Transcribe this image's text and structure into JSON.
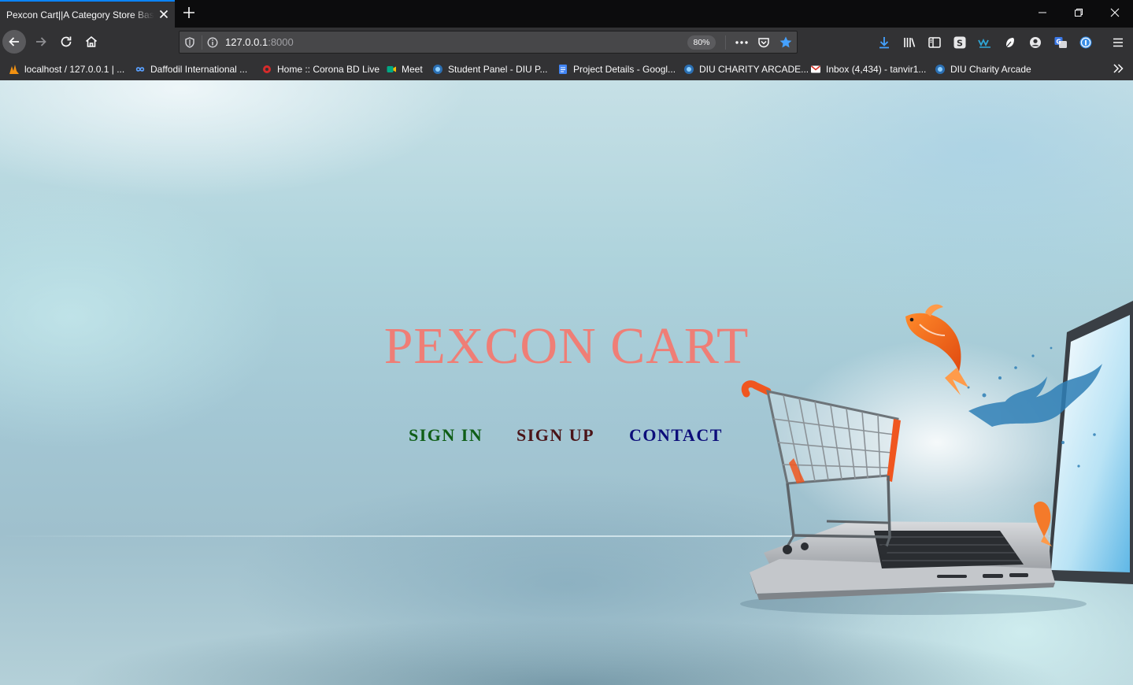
{
  "browser": {
    "tab": {
      "title": "Pexcon Cart||A Category Store Based"
    },
    "url": {
      "host": "127.0.0.1",
      "port": ":8000",
      "zoom": "80%"
    },
    "bookmarks": [
      {
        "label": "localhost / 127.0.0.1 | ...",
        "icon": "phpmyadmin-icon",
        "color": "#f29111"
      },
      {
        "label": "Daffodil International ...",
        "icon": "infinity-icon",
        "color": "#3a7bd5"
      },
      {
        "label": "Home :: Corona BD Live",
        "icon": "corona-icon",
        "color": "#d62b2b"
      },
      {
        "label": "Meet",
        "icon": "meet-icon",
        "color": "#00897b"
      },
      {
        "label": "Student Panel - DIU P...",
        "icon": "diu-icon",
        "color": "#2b6fb3"
      },
      {
        "label": "Project Details - Googl...",
        "icon": "docs-icon",
        "color": "#4285f4"
      },
      {
        "label": "DIU CHARITY ARCADE...",
        "icon": "diu-icon",
        "color": "#2b6fb3"
      },
      {
        "label": "Inbox (4,434) - tanvir1...",
        "icon": "gmail-icon",
        "color": "#d93025"
      },
      {
        "label": "DIU Charity Arcade",
        "icon": "diu-icon",
        "color": "#2b6fb3"
      }
    ]
  },
  "page": {
    "title": "PEXCON CART",
    "nav": {
      "signin": "SIGN IN",
      "signup": "SIGN UP",
      "contact": "CONTACT"
    },
    "colors": {
      "title": "#ef7e76",
      "signin": "#0f5e17",
      "signup": "#4a1418",
      "contact": "#0c0d7a"
    }
  }
}
